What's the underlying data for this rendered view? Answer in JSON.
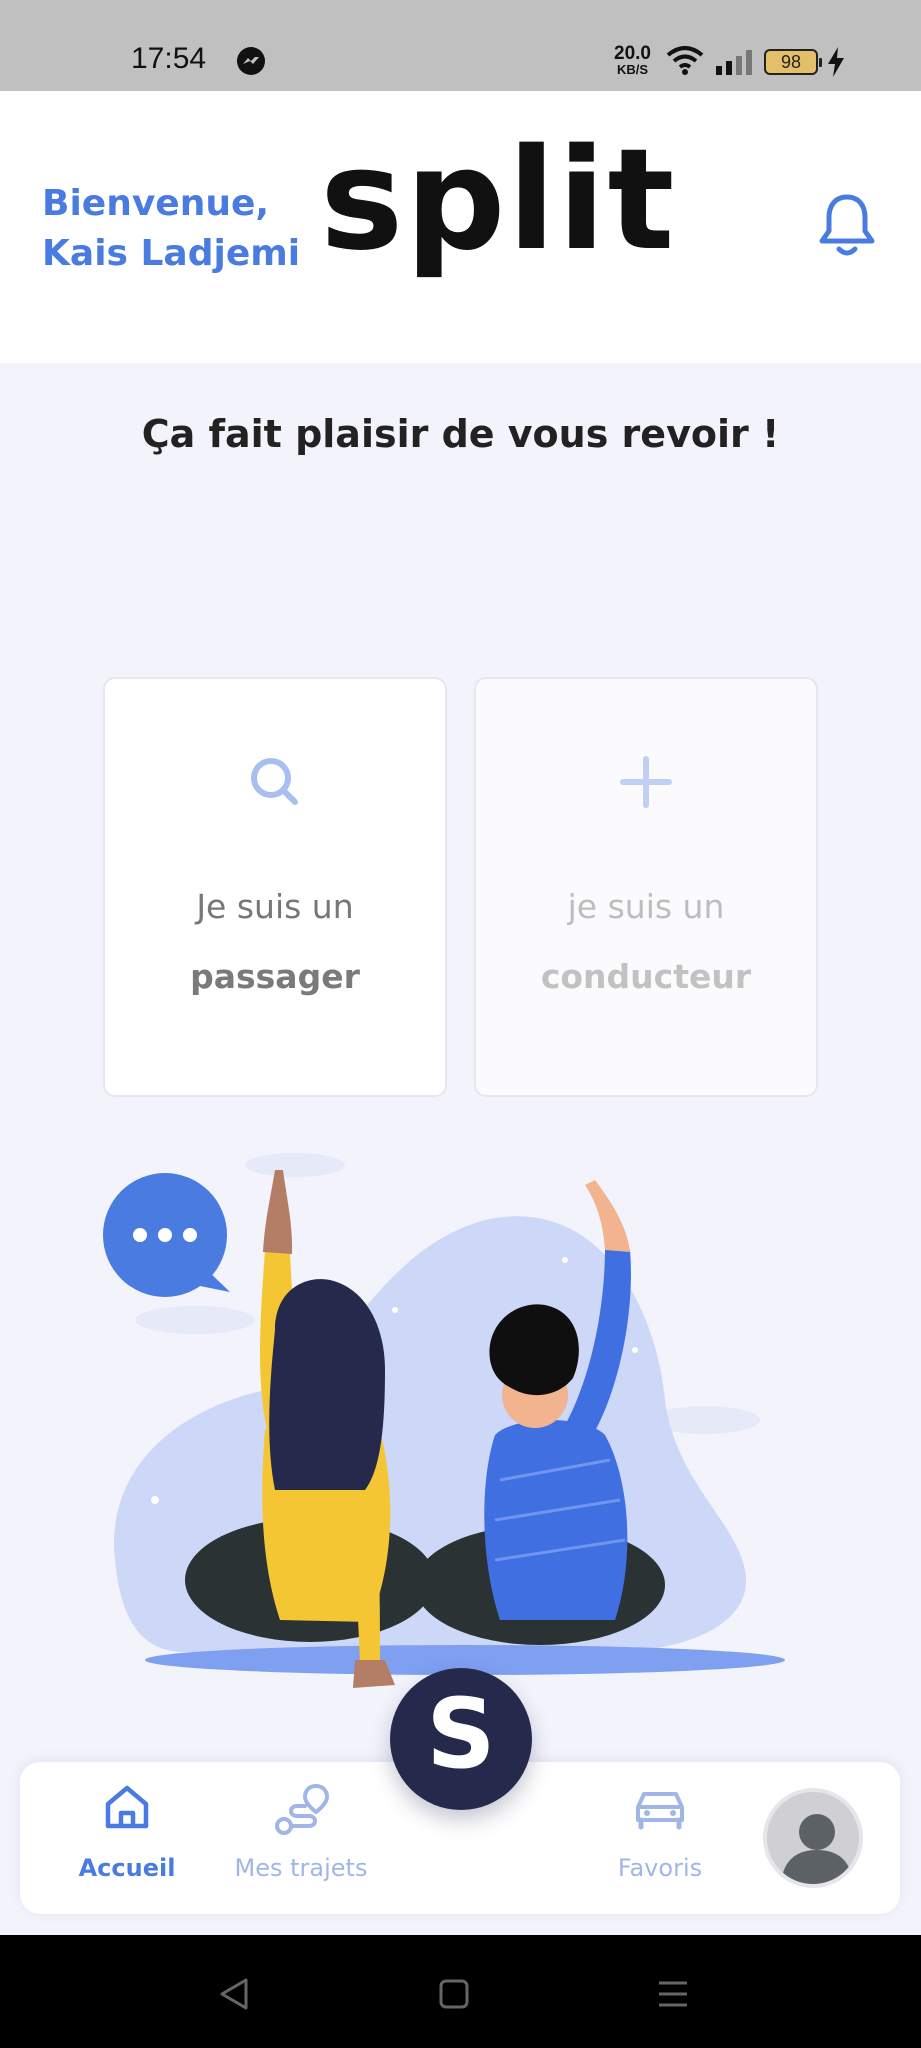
{
  "status_bar": {
    "time": "17:54",
    "net_speed_value": "20.0",
    "net_speed_unit": "KB/S",
    "battery": "98"
  },
  "header": {
    "greeting_line1": "Bienvenue,",
    "greeting_line2": "Kais Ladjemi",
    "logo": "split"
  },
  "main": {
    "welcome": "Ça fait plaisir de vous revoir !",
    "cards": [
      {
        "line1": "Je suis un",
        "line2": "passager",
        "icon": "search-icon"
      },
      {
        "line1": "je suis un",
        "line2": "conducteur",
        "icon": "plus-icon"
      }
    ]
  },
  "bottom_nav": {
    "items": [
      {
        "label": "Accueil",
        "icon": "home-icon",
        "active": true
      },
      {
        "label": "Mes trajets",
        "icon": "route-icon",
        "active": false
      },
      {
        "label": "Favoris",
        "icon": "car-icon",
        "active": false
      }
    ],
    "fab_letter": "S"
  },
  "colors": {
    "accent": "#4a7be0",
    "background": "#f2f3fb",
    "fab": "#252a4d"
  }
}
